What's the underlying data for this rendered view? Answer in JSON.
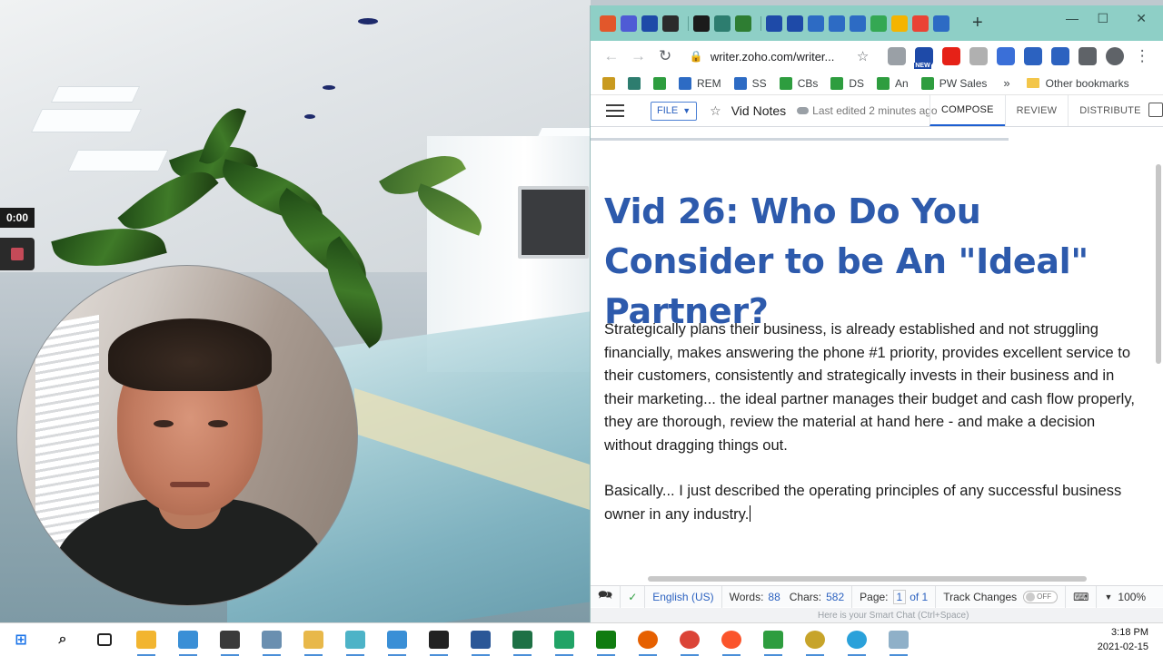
{
  "recorder": {
    "time": "0:00"
  },
  "browser": {
    "tabs": [
      {
        "icon": "link-icon",
        "color": "#e2572b"
      },
      {
        "icon": "puzzle-icon",
        "color": "#4f5bd5"
      },
      {
        "icon": "zoho-app-icon",
        "color": "#1e4aa8"
      },
      {
        "icon": "u-shield-icon",
        "color": "#2b2b2b"
      },
      {
        "icon": "q-icon",
        "color": "#1b1b1b"
      },
      {
        "icon": "home-icon",
        "color": "#2d7d6f"
      },
      {
        "icon": "chat-icon",
        "color": "#2e7d32"
      },
      {
        "icon": "zoho-app-icon",
        "color": "#1e4aa8"
      },
      {
        "icon": "zoho-app-icon",
        "color": "#1e4aa8"
      },
      {
        "icon": "writer-icon",
        "color": "#2d6bc4"
      },
      {
        "icon": "writer-icon",
        "color": "#2d6bc4"
      },
      {
        "icon": "writer-icon",
        "color": "#2d6bc4"
      },
      {
        "icon": "chrome-g-icon",
        "color": "#34a853"
      },
      {
        "icon": "sheet-icon",
        "color": "#f4b400"
      },
      {
        "icon": "sheet-icon",
        "color": "#ea4335"
      },
      {
        "icon": "writer-icon",
        "color": "#2d6bc4"
      }
    ],
    "url": "writer.zoho.com/writer...",
    "extensions": [
      {
        "icon": "code-icon",
        "color": "#9aa0a6"
      },
      {
        "icon": "calendar-new-icon",
        "color": "#1e4aa8",
        "badge": "NEW"
      },
      {
        "icon": "youtube-icon",
        "color": "#e62117"
      },
      {
        "icon": "k-icon",
        "color": "#b0b0b0"
      },
      {
        "icon": "iq-icon",
        "color": "#3a6fd8"
      },
      {
        "icon": "screen-icon",
        "color": "#2c62c0"
      },
      {
        "icon": "gear-icon",
        "color": "#2c62c0"
      },
      {
        "icon": "puzzle-icon",
        "color": "#5f6368"
      },
      {
        "icon": "profile-icon",
        "color": "#5f6368"
      }
    ],
    "bookmarks": [
      {
        "label": "",
        "icon": "folder-icon",
        "color": "#c99a1f"
      },
      {
        "label": "",
        "icon": "home-icon",
        "color": "#2d7d6f"
      },
      {
        "label": "",
        "icon": "hi-icon",
        "color": "#2e9d3f"
      },
      {
        "label": "REM",
        "icon": "writer-icon",
        "color": "#2d6bc4"
      },
      {
        "label": "SS",
        "icon": "writer-icon",
        "color": "#2d6bc4"
      },
      {
        "label": "CBs",
        "icon": "sheet-icon",
        "color": "#2e9d3f"
      },
      {
        "label": "DS",
        "icon": "sheet-icon",
        "color": "#2e9d3f"
      },
      {
        "label": "An",
        "icon": "sheet-icon",
        "color": "#2e9d3f"
      },
      {
        "label": "PW Sales",
        "icon": "sheet-icon",
        "color": "#2e9d3f"
      }
    ],
    "bookmarks_more": "»",
    "other_bookmarks": "Other bookmarks"
  },
  "writer": {
    "file_label": "FILE",
    "doc_name": "Vid Notes",
    "last_edited": "Last edited 2 minutes ago",
    "modes": [
      "COMPOSE",
      "REVIEW",
      "DISTRIBUTE"
    ],
    "active_mode": "COMPOSE",
    "title": "Vid 26: Who Do You Consider to be An \"Ideal\" Partner?",
    "paragraph1": "Strategically plans their business, is already established and not struggling financially, makes answering the phone #1 priority, provides excellent service to their customers, consistently and strategically invests in their business and in their marketing... the ideal partner manages their budget and cash flow properly, they are thorough, review the material at hand here - and make a decision without dragging things out.",
    "paragraph2": "Basically... I just described the operating principles of any successful business owner in any industry.",
    "status": {
      "language": "English (US)",
      "words_label": "Words:",
      "words": "88",
      "chars_label": "Chars:",
      "chars": "582",
      "page_label": "Page:",
      "page": "1",
      "page_of": "of 1",
      "track_changes": "Track Changes",
      "track_state": "OFF",
      "zoom": "100%"
    },
    "chat_placeholder": "Here is your Smart Chat (Ctrl+Space)"
  },
  "taskbar": {
    "items": [
      {
        "icon": "windows-start-icon",
        "color": "#1a73e8"
      },
      {
        "icon": "search-icon",
        "color": "#222222"
      },
      {
        "icon": "task-view-icon",
        "color": "#222222"
      },
      {
        "icon": "file-explorer-icon",
        "color": "#f2b530"
      },
      {
        "icon": "app-window-icon",
        "color": "#3a8fd6"
      },
      {
        "icon": "camtasia-icon",
        "color": "#3a3a3a"
      },
      {
        "icon": "notepad-icon",
        "color": "#6a8fb0"
      },
      {
        "icon": "folder-zip-icon",
        "color": "#e8b84a"
      },
      {
        "icon": "edit-icon",
        "color": "#4db3c7"
      },
      {
        "icon": "send-icon",
        "color": "#3a8fd6"
      },
      {
        "icon": "terminal-icon",
        "color": "#222222"
      },
      {
        "icon": "word-icon",
        "color": "#2b5797"
      },
      {
        "icon": "excel-icon",
        "color": "#1e7145"
      },
      {
        "icon": "camtasia-c-icon",
        "color": "#21a366"
      },
      {
        "icon": "shield-icon",
        "color": "#107c10"
      },
      {
        "icon": "firefox-icon",
        "color": "#e66000"
      },
      {
        "icon": "chrome-icon",
        "color": "#db4437"
      },
      {
        "icon": "brave-icon",
        "color": "#fb542b"
      },
      {
        "icon": "money-icon",
        "color": "#2e9d3f"
      },
      {
        "icon": "zoho-cliq-icon",
        "color": "#c7a42a"
      },
      {
        "icon": "telegram-icon",
        "color": "#2aa1da"
      },
      {
        "icon": "tool-icon",
        "color": "#8fb0c8"
      }
    ],
    "time": "3:18 PM",
    "date": "2021-02-15"
  }
}
